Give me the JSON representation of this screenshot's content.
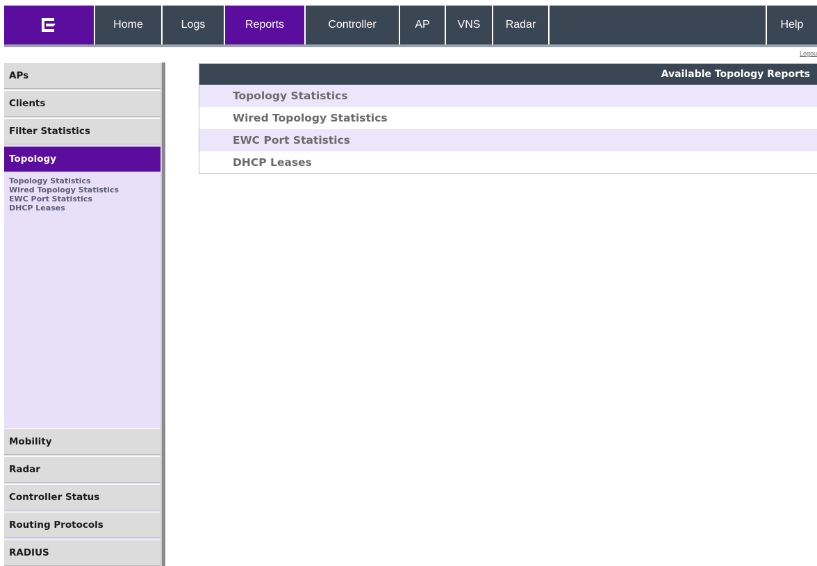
{
  "nav": {
    "logo_icon": "extreme-networks-logo-icon",
    "items": [
      {
        "label": "Home"
      },
      {
        "label": "Logs"
      },
      {
        "label": "Reports"
      },
      {
        "label": "Controller"
      },
      {
        "label": "AP"
      },
      {
        "label": "VNS"
      },
      {
        "label": "Radar"
      }
    ],
    "active": "Reports",
    "help": "Help",
    "logout": "Logou"
  },
  "sidebar": {
    "items": [
      {
        "label": "APs"
      },
      {
        "label": "Clients"
      },
      {
        "label": "Filter Statistics"
      },
      {
        "label": "Topology"
      },
      {
        "label": "Mobility"
      },
      {
        "label": "Radar"
      },
      {
        "label": "Controller Status"
      },
      {
        "label": "Routing Protocols"
      },
      {
        "label": "RADIUS"
      }
    ],
    "active": "Topology",
    "sub_items": [
      {
        "label": "Topology Statistics"
      },
      {
        "label": "Wired Topology Statistics"
      },
      {
        "label": "EWC Port Statistics"
      },
      {
        "label": "DHCP Leases"
      }
    ]
  },
  "report": {
    "title": "Available Topology Reports",
    "rows": [
      {
        "label": "Topology Statistics"
      },
      {
        "label": "Wired Topology Statistics"
      },
      {
        "label": "EWC Port Statistics"
      },
      {
        "label": "DHCP Leases"
      }
    ]
  },
  "colors": {
    "brand_purple": "#5b0d9e",
    "nav_bg": "#3a4654",
    "sidebar_bg": "#e8e0f8",
    "row_shade": "#ebe6fb"
  }
}
